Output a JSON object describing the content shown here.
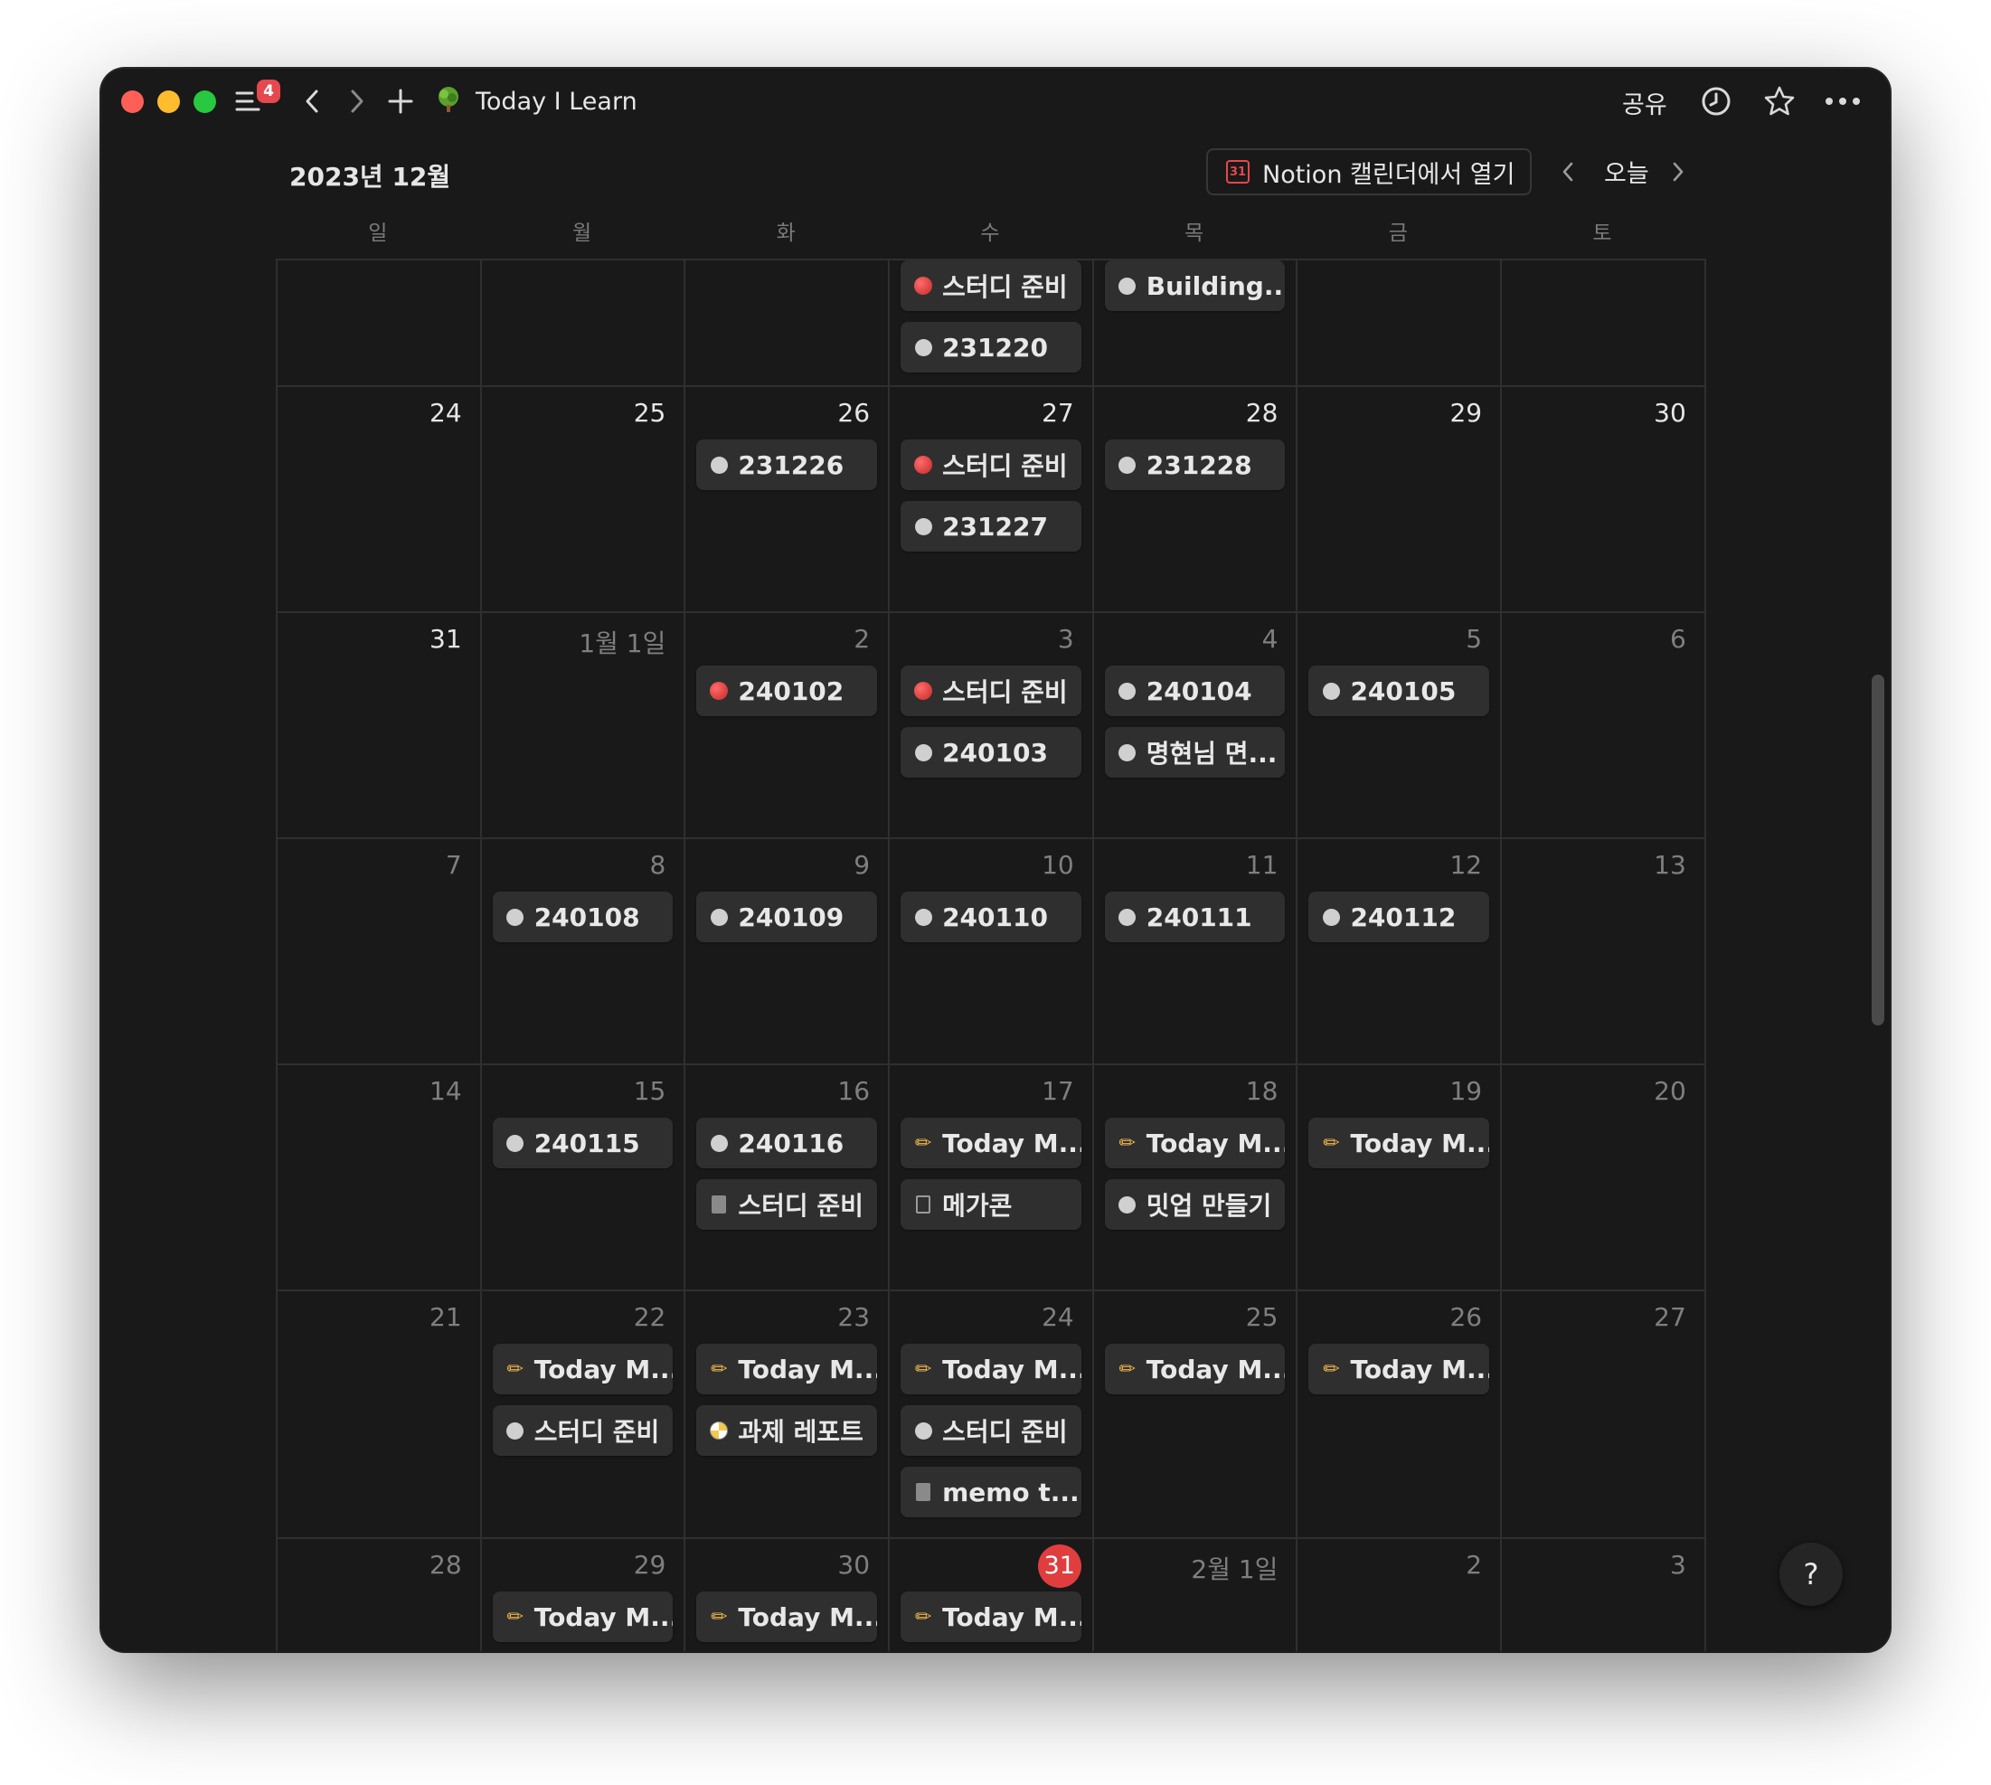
{
  "titlebar": {
    "badge_count": "4",
    "page_title": "Today I Learn",
    "share_label": "공유"
  },
  "calendar": {
    "month_title": "2023년 12월",
    "open_in_notion_calendar": "Notion 캘린더에서 열기",
    "calendar_icon_text": "31",
    "today_label": "오늘",
    "weekdays": [
      "일",
      "월",
      "화",
      "수",
      "목",
      "금",
      "토"
    ]
  },
  "weeks": [
    {
      "days": [
        {
          "num": "",
          "events": []
        },
        {
          "num": "",
          "events": []
        },
        {
          "num": "",
          "events": []
        },
        {
          "num": "",
          "events": [
            {
              "icon": "apple",
              "title": "스터디 준비"
            },
            {
              "icon": "dot",
              "title": "231220"
            }
          ]
        },
        {
          "num": "",
          "events": [
            {
              "icon": "dot",
              "title": "Building..."
            }
          ]
        },
        {
          "num": "",
          "events": []
        },
        {
          "num": "",
          "events": []
        }
      ]
    },
    {
      "days": [
        {
          "num": "24",
          "current": true,
          "events": []
        },
        {
          "num": "25",
          "current": true,
          "events": []
        },
        {
          "num": "26",
          "current": true,
          "events": [
            {
              "icon": "dot",
              "title": "231226"
            }
          ]
        },
        {
          "num": "27",
          "current": true,
          "events": [
            {
              "icon": "apple",
              "title": "스터디 준비"
            },
            {
              "icon": "dot",
              "title": "231227"
            }
          ]
        },
        {
          "num": "28",
          "current": true,
          "events": [
            {
              "icon": "dot",
              "title": "231228"
            }
          ]
        },
        {
          "num": "29",
          "current": true,
          "events": []
        },
        {
          "num": "30",
          "current": true,
          "events": []
        }
      ]
    },
    {
      "days": [
        {
          "num": "31",
          "current": true,
          "events": []
        },
        {
          "num": "1월 1일",
          "events": []
        },
        {
          "num": "2",
          "events": [
            {
              "icon": "apple",
              "title": "240102"
            }
          ]
        },
        {
          "num": "3",
          "events": [
            {
              "icon": "apple",
              "title": "스터디 준비"
            },
            {
              "icon": "dot",
              "title": "240103"
            }
          ]
        },
        {
          "num": "4",
          "events": [
            {
              "icon": "dot",
              "title": "240104"
            },
            {
              "icon": "dot",
              "title": "명현님 면..."
            }
          ]
        },
        {
          "num": "5",
          "events": [
            {
              "icon": "dot",
              "title": "240105"
            }
          ]
        },
        {
          "num": "6",
          "events": []
        }
      ]
    },
    {
      "days": [
        {
          "num": "7",
          "events": []
        },
        {
          "num": "8",
          "events": [
            {
              "icon": "dot",
              "title": "240108"
            }
          ]
        },
        {
          "num": "9",
          "events": [
            {
              "icon": "dot",
              "title": "240109"
            }
          ]
        },
        {
          "num": "10",
          "events": [
            {
              "icon": "dot",
              "title": "240110"
            }
          ]
        },
        {
          "num": "11",
          "events": [
            {
              "icon": "dot",
              "title": "240111"
            }
          ]
        },
        {
          "num": "12",
          "events": [
            {
              "icon": "dot",
              "title": "240112"
            }
          ]
        },
        {
          "num": "13",
          "events": []
        }
      ]
    },
    {
      "days": [
        {
          "num": "14",
          "events": []
        },
        {
          "num": "15",
          "events": [
            {
              "icon": "dot",
              "title": "240115"
            }
          ]
        },
        {
          "num": "16",
          "events": [
            {
              "icon": "dot",
              "title": "240116"
            },
            {
              "icon": "notebook",
              "title": "스터디 준비"
            }
          ]
        },
        {
          "num": "17",
          "events": [
            {
              "icon": "pencil",
              "title": "Today M..."
            },
            {
              "icon": "doc",
              "title": "메가콘"
            }
          ]
        },
        {
          "num": "18",
          "events": [
            {
              "icon": "pencil",
              "title": "Today M..."
            },
            {
              "icon": "dot",
              "title": "밋업 만들기"
            }
          ]
        },
        {
          "num": "19",
          "events": [
            {
              "icon": "pencil",
              "title": "Today M..."
            }
          ]
        },
        {
          "num": "20",
          "events": []
        }
      ]
    },
    {
      "days": [
        {
          "num": "21",
          "events": []
        },
        {
          "num": "22",
          "events": [
            {
              "icon": "pencil",
              "title": "Today M..."
            },
            {
              "icon": "dot",
              "title": "스터디 준비"
            }
          ]
        },
        {
          "num": "23",
          "events": [
            {
              "icon": "pencil",
              "title": "Today M..."
            },
            {
              "icon": "ball",
              "title": "과제 레포트"
            }
          ]
        },
        {
          "num": "24",
          "events": [
            {
              "icon": "pencil",
              "title": "Today M..."
            },
            {
              "icon": "dot",
              "title": "스터디 준비"
            },
            {
              "icon": "notebook",
              "title": "memo t..."
            }
          ]
        },
        {
          "num": "25",
          "events": [
            {
              "icon": "pencil",
              "title": "Today M..."
            }
          ]
        },
        {
          "num": "26",
          "events": [
            {
              "icon": "pencil",
              "title": "Today M..."
            }
          ]
        },
        {
          "num": "27",
          "events": []
        }
      ]
    },
    {
      "days": [
        {
          "num": "28",
          "events": []
        },
        {
          "num": "29",
          "events": [
            {
              "icon": "pencil",
              "title": "Today M..."
            }
          ]
        },
        {
          "num": "30",
          "events": [
            {
              "icon": "pencil",
              "title": "Today M..."
            }
          ]
        },
        {
          "num": "31",
          "today": true,
          "events": [
            {
              "icon": "pencil",
              "title": "Today M..."
            }
          ]
        },
        {
          "num": "2월 1일",
          "events": []
        },
        {
          "num": "2",
          "events": []
        },
        {
          "num": "3",
          "events": []
        }
      ]
    }
  ],
  "help_label": "?",
  "colors": {
    "background": "#191919",
    "event_bg": "#2f2f2f",
    "today_accent": "#e03e3e",
    "badge": "#e5484d"
  }
}
